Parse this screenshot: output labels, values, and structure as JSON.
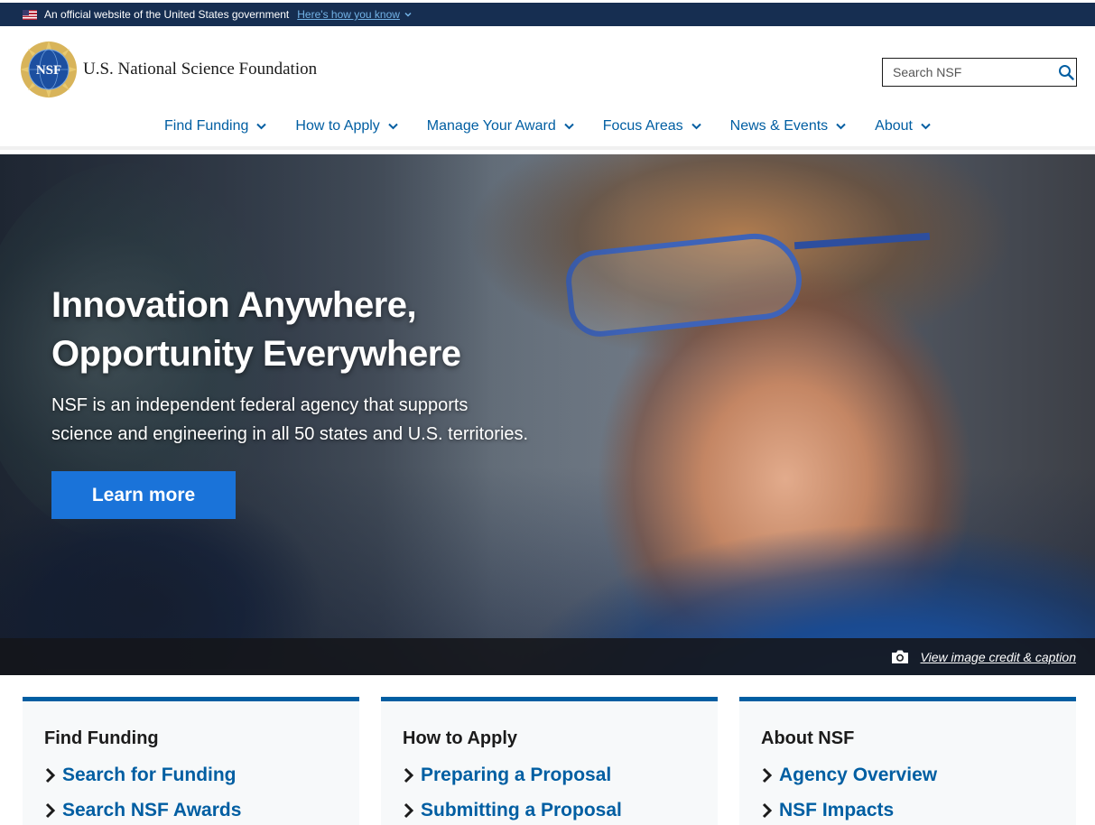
{
  "gov_banner": {
    "text": "An official website of the United States government",
    "link": "Here's how you know",
    "flag_icon": "us-flag-icon"
  },
  "header": {
    "logo_text": "U.S. National Science Foundation",
    "logo_icon": "nsf-seal-logo",
    "search": {
      "placeholder": "Search NSF",
      "value": ""
    }
  },
  "nav": {
    "items": [
      {
        "label": "Find Funding"
      },
      {
        "label": "How to Apply"
      },
      {
        "label": "Manage Your Award"
      },
      {
        "label": "Focus Areas"
      },
      {
        "label": "News & Events"
      },
      {
        "label": "About"
      }
    ]
  },
  "hero": {
    "title_line1": "Innovation Anywhere,",
    "title_line2": "Opportunity Everywhere",
    "description_line1": "NSF is an independent federal agency that supports",
    "description_line2": "science and engineering in all 50 states and U.S. territories.",
    "button": "Learn more",
    "caption_link": "View image credit & caption"
  },
  "cards": [
    {
      "title": "Find Funding",
      "links": [
        "Search for Funding",
        "Search NSF Awards"
      ]
    },
    {
      "title": "How to Apply",
      "links": [
        "Preparing a Proposal",
        "Submitting a Proposal"
      ]
    },
    {
      "title": "About NSF",
      "links": [
        "Agency Overview",
        "NSF Impacts"
      ]
    }
  ],
  "colors": {
    "gov_banner_bg": "#162e51",
    "link_blue": "#005ea2",
    "button_blue": "#1a73d9",
    "nav_text": "#005ea2"
  }
}
